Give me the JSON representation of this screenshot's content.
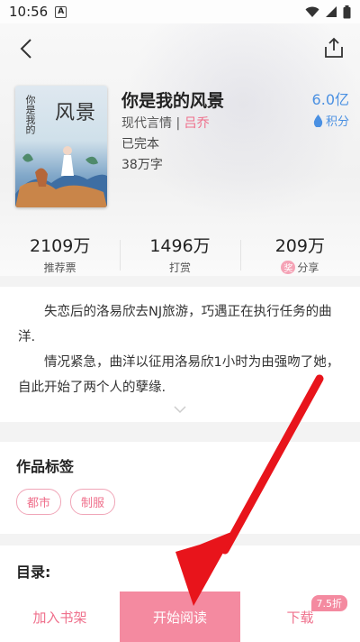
{
  "status_bar": {
    "time": "10:56",
    "app_icon_letter": "A",
    "icons": [
      "wifi-icon",
      "signal-icon",
      "battery-icon"
    ]
  },
  "book": {
    "title": "你是我的风景",
    "genre": "现代言情",
    "separator": " | ",
    "author": "吕乔",
    "status": "已完本",
    "words": "38万字",
    "score_value": "6.0亿",
    "score_label": "积分",
    "cover_text_small": "你是我的",
    "cover_text_big": "风景"
  },
  "stats": [
    {
      "value": "2109万",
      "label": "推荐票"
    },
    {
      "value": "1496万",
      "label": "打赏"
    },
    {
      "value": "209万",
      "badge": "奖",
      "label": "分享"
    }
  ],
  "description": {
    "paragraphs": [
      "失恋后的洛易欣去NJ旅游，巧遇正在执行任务的曲洋.",
      "情况紧急，曲洋以征用洛易欣1小时为由强吻了她，自此开始了两个人的孽缘."
    ]
  },
  "tags_section": {
    "heading": "作品标签",
    "tags": [
      "都市",
      "制服"
    ]
  },
  "toc_section": {
    "heading": "目录:"
  },
  "bottom_bar": {
    "add_shelf": "加入书架",
    "start_read": "开始阅读",
    "download": "下载",
    "discount": "7.5折"
  },
  "colors": {
    "accent_pink": "#ef6f8b",
    "read_button": "#f48aa0",
    "score_blue": "#4a90e2",
    "arrow_red": "#e8141b"
  }
}
